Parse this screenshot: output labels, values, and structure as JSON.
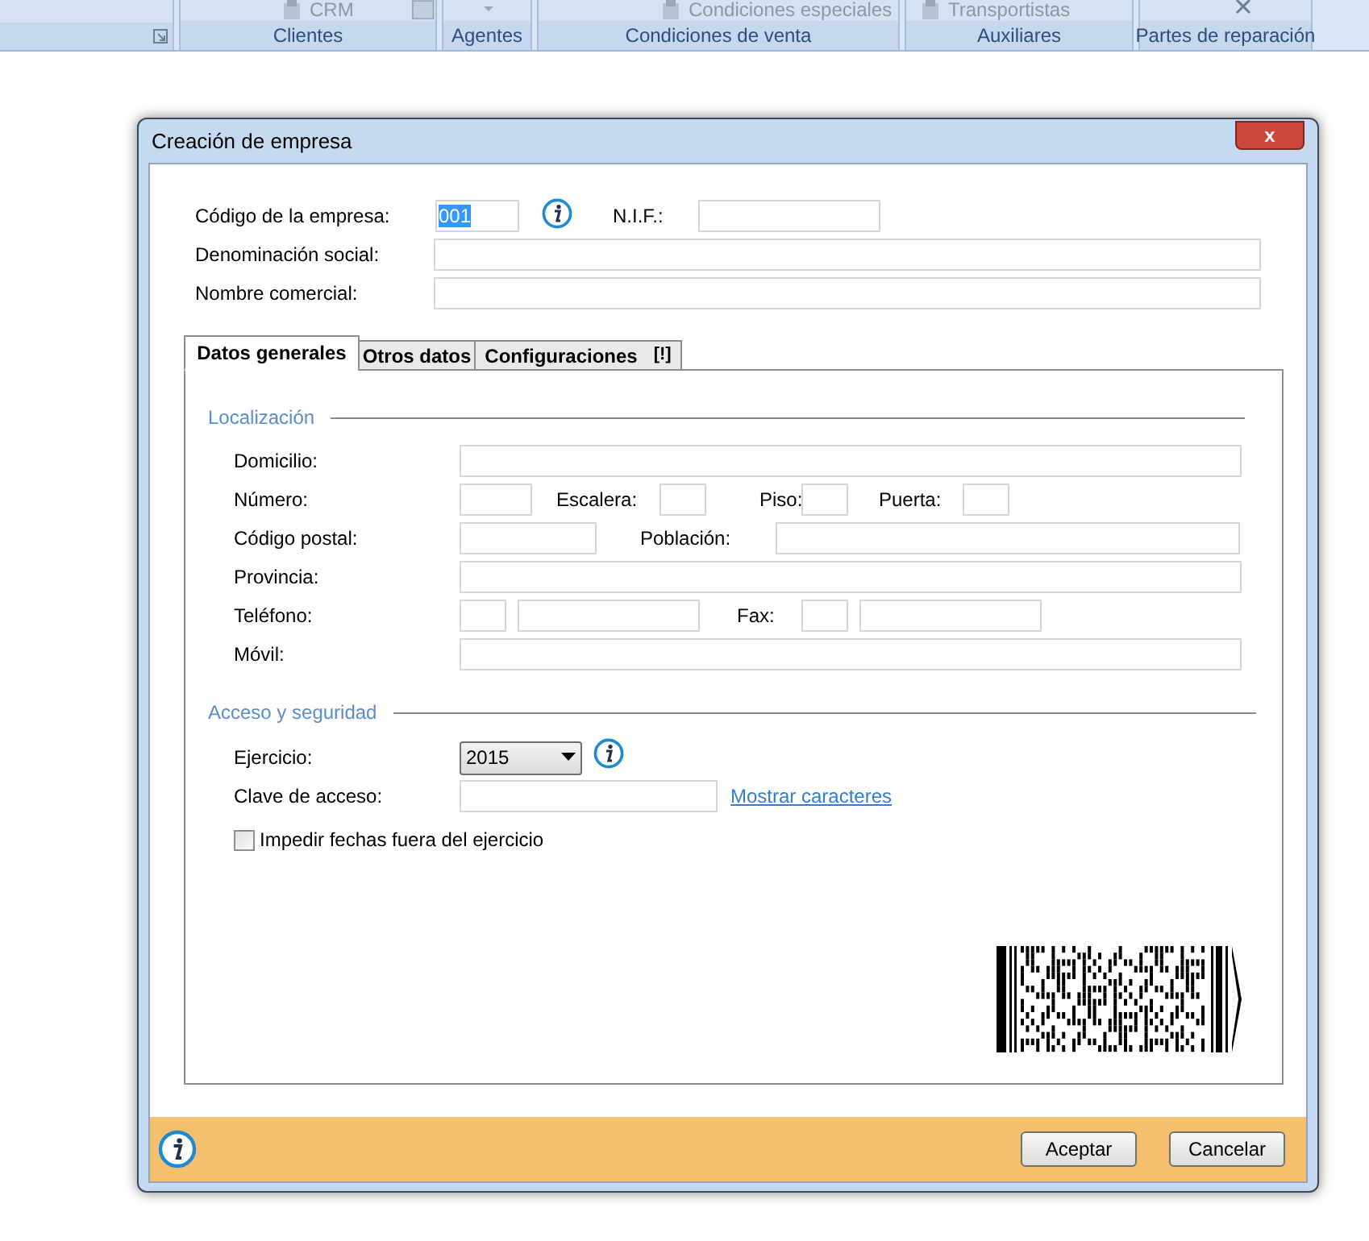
{
  "ribbon": {
    "top_items": [
      {
        "label": "CRM",
        "disabled": true
      },
      {
        "label": "Condiciones especiales",
        "disabled": true
      },
      {
        "label": "Transportistas",
        "disabled": true
      }
    ],
    "groups": [
      "Clientes",
      "Agentes",
      "Condiciones de venta",
      "Auxiliares",
      "Partes de reparación"
    ]
  },
  "dialog": {
    "title": "Creación de empresa",
    "close": "x",
    "header_fields": [
      {
        "label": "Código de la empresa:",
        "value": "001",
        "value_selected": true
      },
      {
        "label": "N.I.F.:"
      },
      {
        "label": "Denominación social:"
      },
      {
        "label": "Nombre comercial:"
      }
    ],
    "tabs": [
      {
        "label": "Datos generales",
        "selected": true
      },
      {
        "label": "Otros datos",
        "selected": false
      },
      {
        "label": "Configuraciones",
        "badge": "[!]",
        "selected": false
      }
    ],
    "localizacion": {
      "title": "Localización",
      "labels": [
        "Domicilio:",
        "Número:",
        "Escalera:",
        "Piso:",
        "Puerta:",
        "Código postal:",
        "Población:",
        "Provincia:",
        "Teléfono:",
        "Fax:",
        "Móvil:"
      ]
    },
    "acceso": {
      "title": "Acceso y seguridad",
      "ejercicio_label": "Ejercicio:",
      "ejercicio_value": "2015",
      "clave_label": "Clave de acceso:",
      "show_link": "Mostrar caracteres",
      "checkbox": {
        "label": "Impedir fechas fuera del ejercicio",
        "checked": false
      }
    },
    "buttons": [
      "Aceptar",
      "Cancelar"
    ]
  }
}
